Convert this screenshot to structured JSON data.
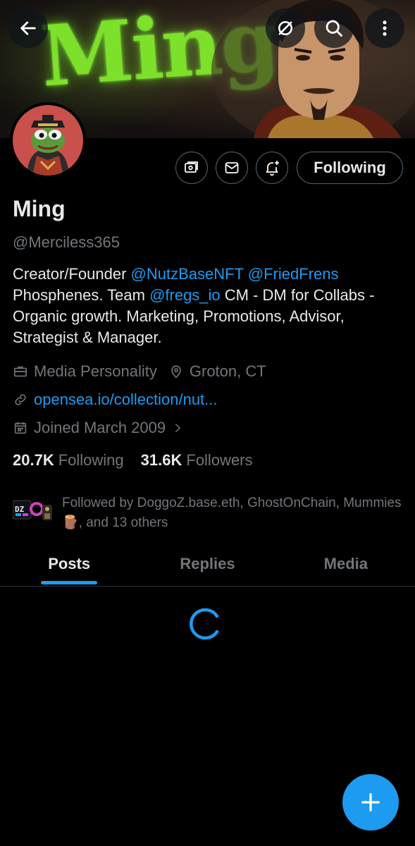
{
  "banner": {
    "text": "Ming"
  },
  "profile": {
    "name": "Ming",
    "handle": "@Merciless365",
    "following_button": "Following",
    "bio": {
      "part1": "Creator/Founder ",
      "mention1": "@NutzBaseNFT",
      "space1": " ",
      "mention2": "@FriedFrens",
      "part2": " Phosphenes. Team ",
      "mention3": "@fregs_io",
      "part3": " CM - DM for Collabs - Organic growth. Marketing, Promotions, Advisor, Strategist & Manager."
    },
    "category": "Media Personality",
    "location": "Groton, CT",
    "website": "opensea.io/collection/nut...",
    "joined": "Joined March 2009",
    "following_count": "20.7K",
    "following_label": "Following",
    "followers_count": "31.6K",
    "followers_label": "Followers",
    "followed_by": "Followed by DoggoZ.base.eth, GhostOnChain, Mummies 🪵, and 13 others"
  },
  "tabs": [
    {
      "label": "Posts",
      "active": true
    },
    {
      "label": "Replies",
      "active": false
    },
    {
      "label": "Media",
      "active": false
    }
  ],
  "colors": {
    "accent": "#1d9bf0",
    "muted": "#71767b",
    "text": "#e7e9ea",
    "banner_text": "#7de02a"
  },
  "icons": [
    "back-arrow-icon",
    "grok-icon",
    "search-icon",
    "more-vertical-icon",
    "subscription-icon",
    "mail-icon",
    "notification-bell-icon",
    "briefcase-icon",
    "location-pin-icon",
    "link-icon",
    "calendar-icon",
    "chevron-right-icon",
    "loading-spinner-icon",
    "plus-icon"
  ]
}
